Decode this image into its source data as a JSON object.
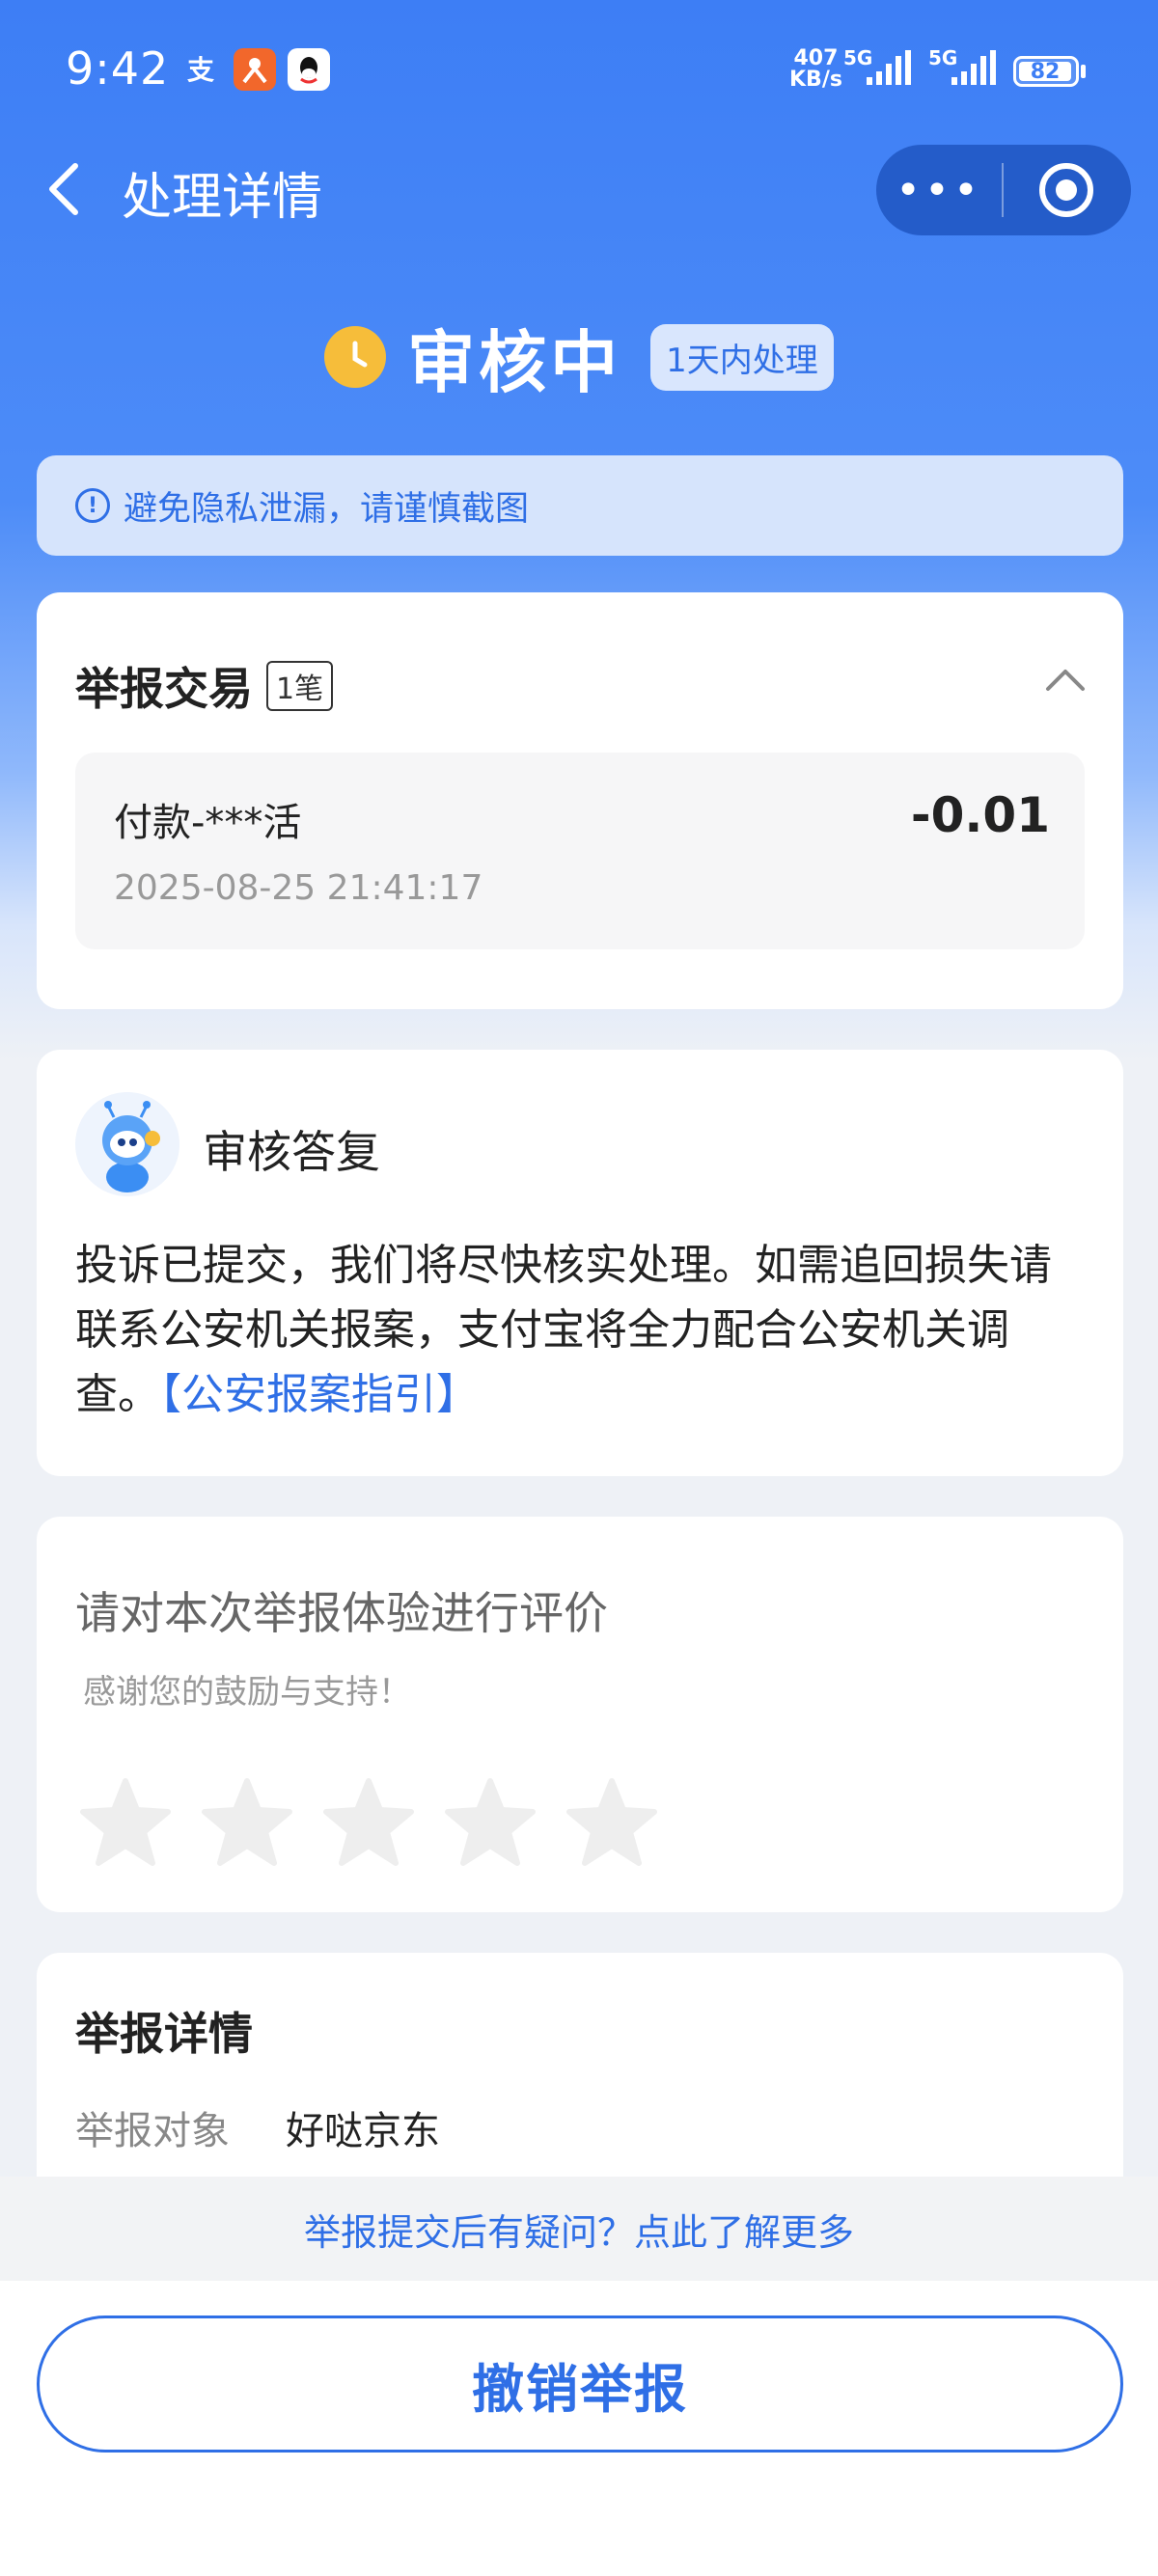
{
  "status_bar": {
    "time": "9:42",
    "speed_value": "407",
    "speed_unit": "KB/s",
    "network_1": "5G",
    "network_2": "5G",
    "battery": "82",
    "app_icons": [
      "alipay-icon",
      "taobao-icon",
      "qq-icon"
    ]
  },
  "nav": {
    "title": "处理详情",
    "more_label": "•••"
  },
  "review_status": {
    "label": "审核中",
    "badge": "1天内处理"
  },
  "privacy_banner": {
    "text": "避免隐私泄漏，请谨慎截图"
  },
  "report_transaction": {
    "title": "举报交易",
    "count_badge": "1笔",
    "transaction": {
      "name": "付款-***活",
      "amount": "-0.01",
      "datetime": "2025-08-25 21:41:17"
    }
  },
  "review_reply": {
    "title": "审核答复",
    "body": "投诉已提交，我们将尽快核实处理。如需追回损失请联系公安机关报案，支付宝将全力配合公安机关调查。",
    "link": "【公安报案指引】"
  },
  "rating": {
    "title": "请对本次举报体验进行评价",
    "subtitle": "感谢您的鼓励与支持！",
    "max_stars": 5,
    "selected_stars": 0
  },
  "report_details": {
    "title": "举报详情",
    "rows": [
      {
        "label": "举报对象",
        "value": "好哒京东"
      }
    ]
  },
  "help_link": "举报提交后有疑问？点此了解更多",
  "cancel_button": "撤销举报",
  "colors": {
    "primary_blue": "#2f6fe6",
    "header_blue": "#3d7ef5",
    "clock_yellow": "#f6bd3a",
    "star_gray": "#eeeeee"
  }
}
